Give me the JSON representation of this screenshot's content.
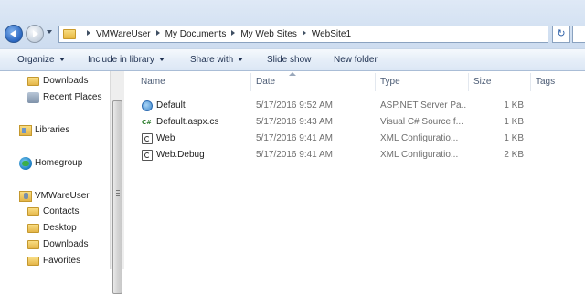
{
  "address_bar": {
    "crumbs": [
      "VMWareUser",
      "My Documents",
      "My Web Sites",
      "WebSite1"
    ]
  },
  "command_bar": {
    "organize": "Organize",
    "include_in_library": "Include in library",
    "share_with": "Share with",
    "slide_show": "Slide show",
    "new_folder": "New folder"
  },
  "nav_pane": {
    "items": [
      {
        "label": "Downloads",
        "icon": "folder-icon"
      },
      {
        "label": "Recent Places",
        "icon": "recent-places-icon"
      },
      {
        "label": "Libraries",
        "icon": "libraries-icon"
      },
      {
        "label": "Homegroup",
        "icon": "homegroup-icon"
      },
      {
        "label": "VMWareUser",
        "icon": "user-folder-icon"
      },
      {
        "label": "Contacts",
        "icon": "folder-icon"
      },
      {
        "label": "Desktop",
        "icon": "folder-icon"
      },
      {
        "label": "Downloads",
        "icon": "folder-icon"
      },
      {
        "label": "Favorites",
        "icon": "folder-icon"
      }
    ]
  },
  "file_list": {
    "columns": {
      "name": "Name",
      "date": "Date",
      "type": "Type",
      "size": "Size",
      "tags": "Tags"
    },
    "rows": [
      {
        "name": "Default",
        "date": "5/17/2016 9:52 AM",
        "type": "ASP.NET Server Pa...",
        "size": "1 KB",
        "icon": "aspx-globe-icon"
      },
      {
        "name": "Default.aspx.cs",
        "date": "5/17/2016 9:43 AM",
        "type": "Visual C# Source f...",
        "size": "1 KB",
        "icon": "csharp-file-icon"
      },
      {
        "name": "Web",
        "date": "5/17/2016 9:41 AM",
        "type": "XML Configuratio...",
        "size": "1 KB",
        "icon": "config-file-icon"
      },
      {
        "name": "Web.Debug",
        "date": "5/17/2016 9:41 AM",
        "type": "XML Configuratio...",
        "size": "2 KB",
        "icon": "config-file-icon"
      }
    ]
  },
  "colors": {
    "chrome_top": "#dfe9f6",
    "command_bar": "#e6eef8",
    "header_text": "#4b5b74"
  }
}
